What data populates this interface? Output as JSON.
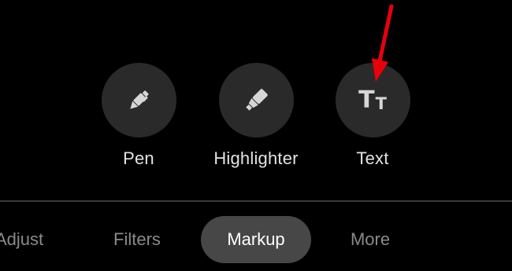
{
  "tools": {
    "pen": {
      "label": "Pen",
      "icon": "pen-icon"
    },
    "highlighter": {
      "label": "Highlighter",
      "icon": "highlighter-icon"
    },
    "text": {
      "label": "Text",
      "icon": "text-format-icon",
      "glyph_big": "T",
      "glyph_small": "T"
    }
  },
  "tabs": {
    "adjust": "Adjust",
    "filters": "Filters",
    "markup": "Markup",
    "more": "More",
    "selected": "Markup"
  },
  "colors": {
    "background": "#000000",
    "tool_circle": "#2a2a2a",
    "selected_tab": "#474747",
    "annotation_arrow": "#e8000b"
  }
}
